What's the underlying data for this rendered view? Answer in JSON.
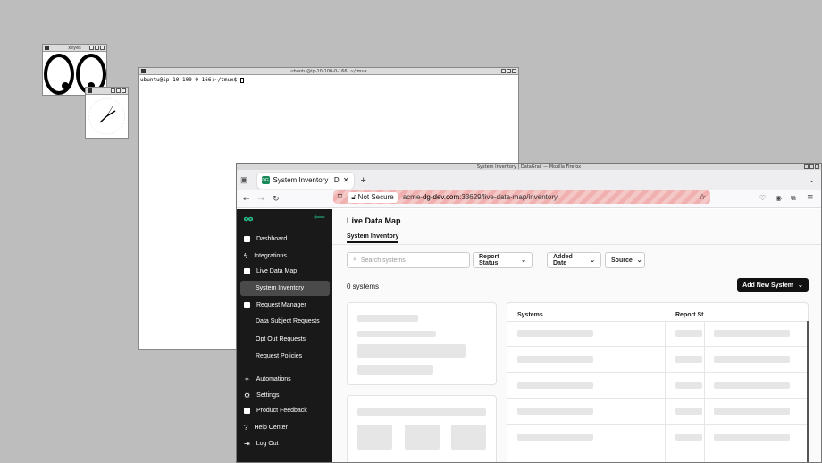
{
  "xeyes": {
    "title": "xeyes"
  },
  "xclock": {
    "title": "xclock"
  },
  "terminal": {
    "title": "ubuntu@ip-10-100-0-166: ~/tmux",
    "prompt": "ubuntu@ip-10-100-0-166:~/tmux$ "
  },
  "firefox": {
    "window_title": "System Inventory | DataGrail — Mozilla Firefox",
    "tab_label": "System Inventory | Data",
    "not_secure": "Not Secure",
    "url_prefix": "acme-",
    "url_host": "dg-dev.com",
    "url_rest": ":33629/live-data-map/inventory"
  },
  "sidebar": {
    "items": [
      {
        "label": "Dashboard",
        "icon": "bar-chart-icon"
      },
      {
        "label": "Integrations",
        "icon": "bolt-icon"
      },
      {
        "label": "Live Data Map",
        "icon": "map-icon"
      },
      {
        "label": "System Inventory"
      },
      {
        "label": "Request Manager",
        "icon": "list-icon"
      },
      {
        "label": "Data Subject Requests"
      },
      {
        "label": "Opt Out Requests"
      },
      {
        "label": "Request Policies"
      },
      {
        "label": "Automations",
        "icon": "wand-icon"
      },
      {
        "label": "Settings",
        "icon": "gear-icon"
      },
      {
        "label": "Product Feedback",
        "icon": "feedback-icon"
      },
      {
        "label": "Help Center",
        "icon": "help-icon"
      },
      {
        "label": "Log Out",
        "icon": "logout-icon"
      }
    ]
  },
  "main": {
    "title": "Live Data Map",
    "subtab": "System Inventory",
    "search_placeholder": "Search systems",
    "filters": [
      "Report Status",
      "Added Date",
      "Source"
    ],
    "count": "0 systems",
    "add_button": "Add New System",
    "columns": [
      "Systems",
      "Report St"
    ]
  },
  "colors": {
    "sidebar": "#191919",
    "accent": "#1a8a5a",
    "button": "#111111"
  }
}
